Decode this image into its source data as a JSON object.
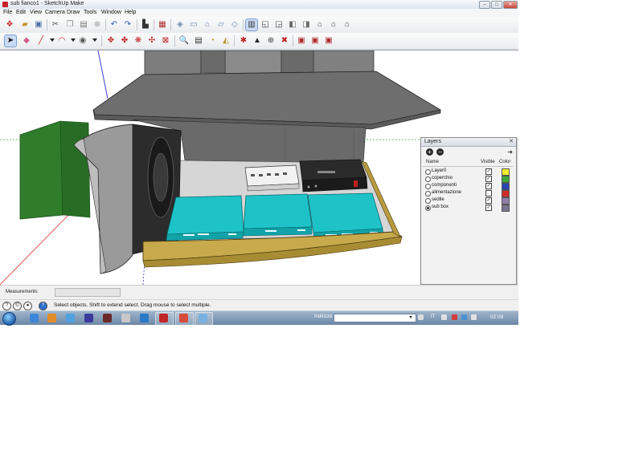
{
  "window": {
    "title": "sub fianco1 - SketchUp Make"
  },
  "menu": [
    "File",
    "Edit",
    "View",
    "Camera",
    "Draw",
    "Tools",
    "Window",
    "Help"
  ],
  "icons": {
    "toolbar1": [
      "getting-started-icon",
      "open-icon",
      "save-icon",
      "cut-icon",
      "copy-icon",
      "paste-icon",
      "erase-icon",
      "undo-icon",
      "redo-icon",
      "print-icon",
      "model-info-icon",
      "iso-view-icon",
      "top-view-icon",
      "front-view-icon",
      "right-view-icon",
      "back-view-icon",
      "left-view-icon",
      "xray-icon",
      "wireframe-icon",
      "hidden-line-icon",
      "shaded-icon",
      "shaded-texture-icon",
      "monochrome-icon",
      "warehouse-icon",
      "share-model-icon",
      "components-icon",
      "extension-warehouse-icon",
      "house-icon"
    ],
    "toolbar2": [
      "select-icon",
      "eraser-icon",
      "pencil-icon",
      "arc-icon",
      "paint-bucket-icon",
      "push-pull-icon",
      "move-icon",
      "rotate-icon",
      "scale-icon",
      "offset-icon",
      "tape-measure-icon",
      "text-icon",
      "protractor-icon",
      "follow-me-icon",
      "axes-icon",
      "section-plane-icon",
      "orbit-icon",
      "pan-icon",
      "zoom-icon",
      "zoom-extents-icon",
      "walk-icon",
      "look-around-icon",
      "position-camera-icon",
      "sandbox-icon"
    ]
  },
  "layers_panel": {
    "title": "Layers",
    "headers": {
      "name": "Name",
      "visible": "Visible",
      "color": "Color"
    },
    "rows": [
      {
        "name": "Layer0",
        "active": false,
        "visible": true,
        "color": "#f2ef2a"
      },
      {
        "name": "coperchio",
        "active": false,
        "visible": true,
        "color": "#3fa83a"
      },
      {
        "name": "componenti",
        "active": false,
        "visible": true,
        "color": "#2a46b0"
      },
      {
        "name": "alimentazione",
        "active": false,
        "visible": false,
        "color": "#d22a2a"
      },
      {
        "name": "sedile",
        "active": false,
        "visible": true,
        "color": "#8f7fa8"
      },
      {
        "name": "sub box",
        "active": true,
        "visible": true,
        "color": "#7a7590"
      }
    ]
  },
  "measurements": {
    "label": "Measurements",
    "value": ""
  },
  "status": {
    "text": "Select objects. Shift to extend select. Drag mouse to select multiple."
  },
  "taskbar": {
    "address_label": "Indirizzo",
    "lang": "IT",
    "time": "02:09"
  }
}
